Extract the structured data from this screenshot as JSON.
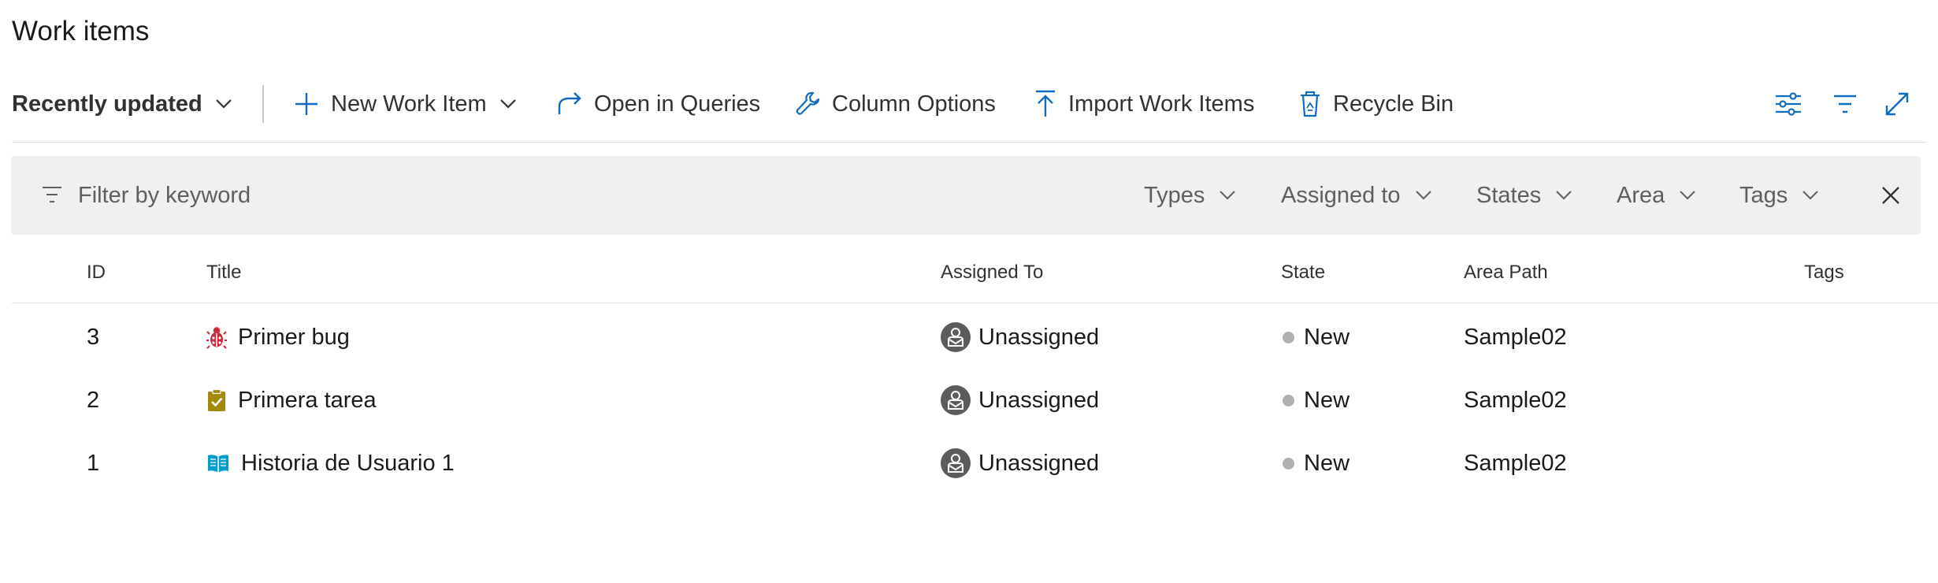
{
  "page": {
    "title": "Work items"
  },
  "toolbar": {
    "view_selector": "Recently updated",
    "new_work_item": "New Work Item",
    "open_in_queries": "Open in Queries",
    "column_options": "Column Options",
    "import_work_items": "Import Work Items",
    "recycle_bin": "Recycle Bin",
    "right_icons": [
      "view-options-icon",
      "filter-icon",
      "fullscreen-icon"
    ]
  },
  "filter": {
    "placeholder": "Filter by keyword",
    "value": "",
    "dropdowns": [
      "Types",
      "Assigned to",
      "States",
      "Area",
      "Tags"
    ]
  },
  "grid": {
    "columns": [
      "ID",
      "Title",
      "Assigned To",
      "State",
      "Area Path",
      "Tags"
    ],
    "rows": [
      {
        "id": "3",
        "type_icon": "bug-icon",
        "title": "Primer bug",
        "assigned_to": "Unassigned",
        "state": "New",
        "area_path": "Sample02",
        "tags": ""
      },
      {
        "id": "2",
        "type_icon": "task-icon",
        "title": "Primera tarea",
        "assigned_to": "Unassigned",
        "state": "New",
        "area_path": "Sample02",
        "tags": ""
      },
      {
        "id": "1",
        "type_icon": "user-story-icon",
        "title": "Historia de Usuario 1",
        "assigned_to": "Unassigned",
        "state": "New",
        "area_path": "Sample02",
        "tags": ""
      }
    ]
  },
  "colors": {
    "accent": "#0f6cbd",
    "bug": "#cc293d",
    "task": "#a4880a",
    "user_story": "#009ccc",
    "state_new": "#b2b0ae",
    "filter_bg": "#f0f0f0"
  }
}
